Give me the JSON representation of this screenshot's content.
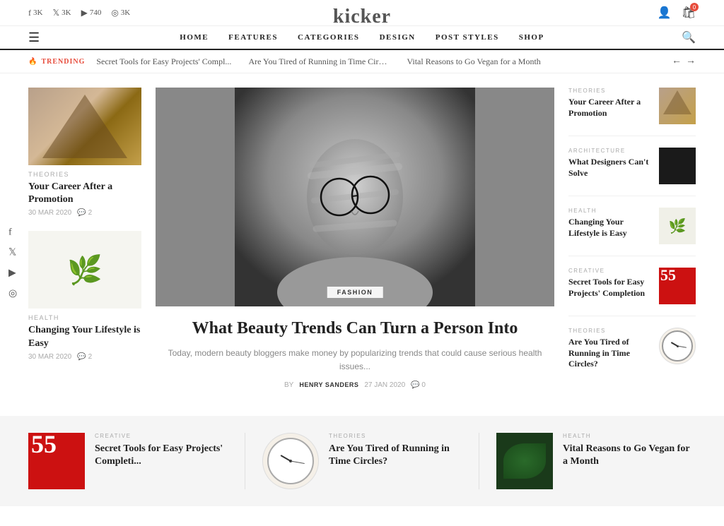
{
  "site": {
    "name": "kicker"
  },
  "social": {
    "facebook": {
      "icon": "f",
      "count": "3K"
    },
    "twitter": {
      "icon": "𝕏",
      "count": "3K"
    },
    "youtube": {
      "icon": "▶",
      "count": "740"
    },
    "instagram": {
      "icon": "◎",
      "count": "3K"
    }
  },
  "nav": {
    "items": [
      "HOME",
      "FEATURES",
      "CATEGORIES",
      "DESIGN",
      "POST STYLES",
      "SHOP"
    ]
  },
  "trending": {
    "label": "TRENDING",
    "items": [
      "Secret Tools for Easy Projects' Compl...",
      "Are You Tired of Running in Time Circl...",
      "Vital Reasons to Go Vegan for a Month"
    ]
  },
  "left_articles": [
    {
      "category": "THEORIES",
      "title": "Your Career After a Promotion",
      "date": "30 MAR 2020",
      "comments": "2",
      "thumb_type": "geometric"
    },
    {
      "category": "HEALTH",
      "title": "Changing Your Lifestyle is Easy",
      "date": "30 MAR 2020",
      "comments": "2",
      "thumb_type": "plant"
    }
  ],
  "feature": {
    "badge": "FASHION",
    "title": "What Beauty Trends Can Turn a Person Into",
    "excerpt": "Today, modern beauty bloggers make money by popularizing trends that could cause serious health issues...",
    "by": "BY",
    "author": "HENRY SANDERS",
    "date": "27 JAN 2020",
    "comments": "0"
  },
  "right_articles": [
    {
      "category": "THEORIES",
      "title": "Your Career After a Promotion",
      "thumb_type": "geo"
    },
    {
      "category": "ARCHITECTURE",
      "title": "What Designers Can't Solve",
      "thumb_type": "black"
    },
    {
      "category": "HEALTH",
      "title": "Changing Your Lifestyle is Easy",
      "thumb_type": "plant"
    },
    {
      "category": "CREATIVE",
      "title": "Secret Tools for Easy Projects' Completion",
      "thumb_type": "red"
    },
    {
      "category": "THEORIES",
      "title": "Are You Tired of Running in Time Circles?",
      "thumb_type": "clock"
    }
  ],
  "bottom_cards": [
    {
      "category": "CREATIVE",
      "title": "Secret Tools for Easy Projects' Completi...",
      "thumb_type": "red"
    },
    {
      "category": "THEORIES",
      "title": "Are You Tired of Running in Time Circles?",
      "thumb_type": "clock"
    },
    {
      "category": "HEALTH",
      "title": "Vital Reasons to Go Vegan for a Month",
      "thumb_type": "leaves"
    }
  ],
  "vertical_social": {
    "icons": [
      "f",
      "𝕏",
      "▶",
      "◎"
    ]
  }
}
